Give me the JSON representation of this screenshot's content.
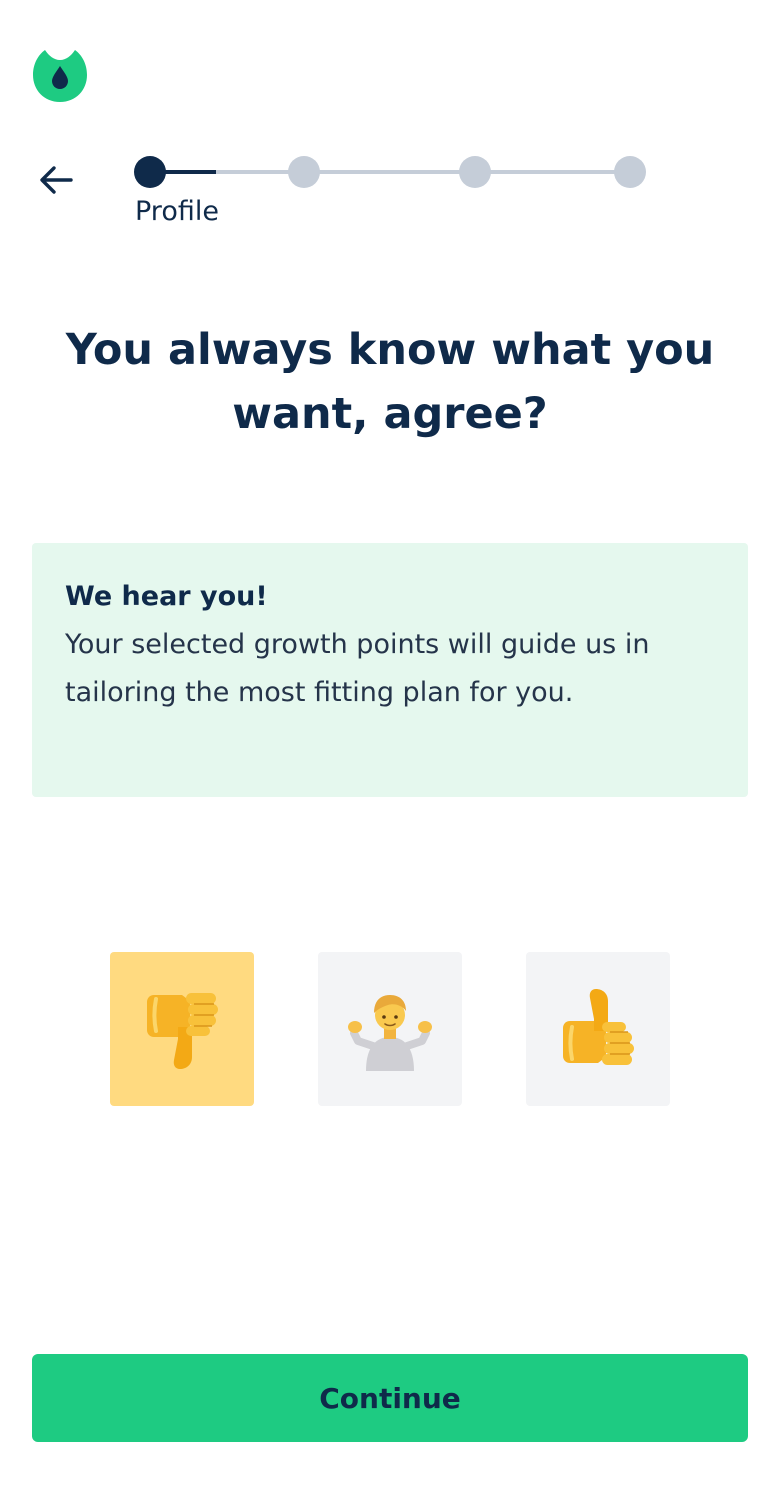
{
  "colors": {
    "brand_green": "#1ecb82",
    "navy": "#0f2a4a",
    "step_inactive": "#c5cdd8",
    "info_background": "#e5f8ee",
    "selected_choice": "#ffda80",
    "choice_background": "#f3f4f6"
  },
  "header": {
    "logo_icon": "drop-leaf-logo-icon",
    "back_icon": "arrow-left-icon"
  },
  "progress": {
    "current_step": 1,
    "total_steps": 4,
    "current_label": "Profile"
  },
  "question": {
    "line1": "You always know what you",
    "line2": "want, agree?"
  },
  "info": {
    "title": "We hear you!",
    "body": "Your selected growth points will guide us in tailoring the most fitting plan for you."
  },
  "choices": [
    {
      "icon": "thumbs-down-icon",
      "selected": true
    },
    {
      "icon": "person-shrugging-icon",
      "selected": false
    },
    {
      "icon": "thumbs-up-icon",
      "selected": false
    }
  ],
  "footer": {
    "continue_label": "Continue"
  }
}
